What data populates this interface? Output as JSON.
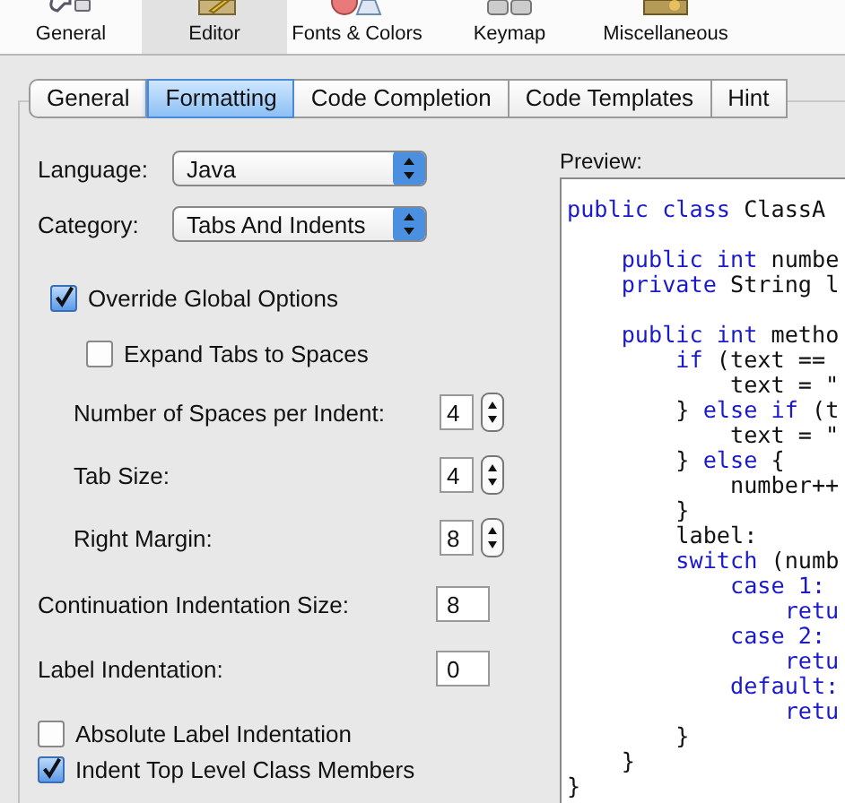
{
  "toolbar": [
    {
      "label": "General",
      "selected": false
    },
    {
      "label": "Editor",
      "selected": true
    },
    {
      "label": "Fonts & Colors",
      "selected": false
    },
    {
      "label": "Keymap",
      "selected": false
    },
    {
      "label": "Miscellaneous",
      "selected": false
    }
  ],
  "tabs": [
    {
      "label": "General",
      "selected": false
    },
    {
      "label": "Formatting",
      "selected": true
    },
    {
      "label": "Code Completion",
      "selected": false
    },
    {
      "label": "Code Templates",
      "selected": false
    },
    {
      "label": "Hint",
      "selected": false
    }
  ],
  "selects": [
    {
      "label": "Language:",
      "value": "Java"
    },
    {
      "label": "Category:",
      "value": "Tabs And Indents"
    }
  ],
  "override": {
    "label": "Override Global Options",
    "checked": true
  },
  "expand_tabs": {
    "label": "Expand Tabs to Spaces",
    "checked": false
  },
  "spin_fields": [
    {
      "label": "Number of Spaces per Indent:",
      "value": "4"
    },
    {
      "label": "Tab Size:",
      "value": "4"
    },
    {
      "label": "Right Margin:",
      "value": "8"
    }
  ],
  "text_fields": [
    {
      "label": "Continuation Indentation Size:",
      "value": "8"
    },
    {
      "label": "Label Indentation:",
      "value": "0"
    }
  ],
  "checkboxes": [
    {
      "label": "Absolute Label Indentation",
      "checked": false
    },
    {
      "label": "Indent Top Level Class Members",
      "checked": true
    }
  ],
  "preview": {
    "label": "Preview:",
    "blocks": [
      {
        "lines": [
          {
            "segments": [
              {
                "kind": "keyword",
                "text": "public class "
              },
              {
                "kind": "plain",
                "text": "ClassA"
              }
            ]
          }
        ]
      },
      {
        "lines": [
          {
            "segments": [
              {
                "kind": "keyword",
                "text": "    public int "
              },
              {
                "kind": "plain",
                "text": "numbe"
              }
            ]
          },
          {
            "segments": [
              {
                "kind": "keyword",
                "text": "    private "
              },
              {
                "kind": "plain",
                "text": "String l"
              }
            ]
          }
        ]
      },
      {
        "lines": [
          {
            "segments": [
              {
                "kind": "keyword",
                "text": "    public int "
              },
              {
                "kind": "plain",
                "text": "metho"
              }
            ]
          },
          {
            "segments": [
              {
                "kind": "keyword",
                "text": "        if "
              },
              {
                "kind": "plain",
                "text": "(text =="
              }
            ]
          },
          {
            "segments": [
              {
                "kind": "plain",
                "text": "            text = \""
              }
            ]
          },
          {
            "segments": [
              {
                "kind": "plain",
                "text": "        } "
              },
              {
                "kind": "keyword",
                "text": "else if "
              },
              {
                "kind": "plain",
                "text": "(t"
              }
            ]
          },
          {
            "segments": [
              {
                "kind": "plain",
                "text": "            text = \""
              }
            ]
          },
          {
            "segments": [
              {
                "kind": "plain",
                "text": "        } "
              },
              {
                "kind": "keyword",
                "text": "else "
              },
              {
                "kind": "plain",
                "text": "{"
              }
            ]
          },
          {
            "segments": [
              {
                "kind": "plain",
                "text": "            number++"
              }
            ]
          },
          {
            "segments": [
              {
                "kind": "plain",
                "text": "        }"
              }
            ]
          },
          {
            "segments": [
              {
                "kind": "plain",
                "text": "        label:"
              }
            ]
          },
          {
            "segments": [
              {
                "kind": "keyword",
                "text": "        switch "
              },
              {
                "kind": "plain",
                "text": "(numb"
              }
            ]
          },
          {
            "segments": [
              {
                "kind": "keyword",
                "text": "            case 1:"
              }
            ]
          },
          {
            "segments": [
              {
                "kind": "keyword",
                "text": "                retu"
              }
            ]
          },
          {
            "segments": [
              {
                "kind": "keyword",
                "text": "            case 2:"
              }
            ]
          },
          {
            "segments": [
              {
                "kind": "keyword",
                "text": "                retu"
              }
            ]
          },
          {
            "segments": [
              {
                "kind": "keyword",
                "text": "            default:"
              }
            ]
          },
          {
            "segments": [
              {
                "kind": "keyword",
                "text": "                retu"
              }
            ]
          },
          {
            "segments": [
              {
                "kind": "plain",
                "text": "        }"
              }
            ]
          },
          {
            "segments": [
              {
                "kind": "plain",
                "text": "    }"
              }
            ]
          },
          {
            "segments": [
              {
                "kind": "plain",
                "text": "}"
              }
            ]
          }
        ]
      }
    ]
  }
}
